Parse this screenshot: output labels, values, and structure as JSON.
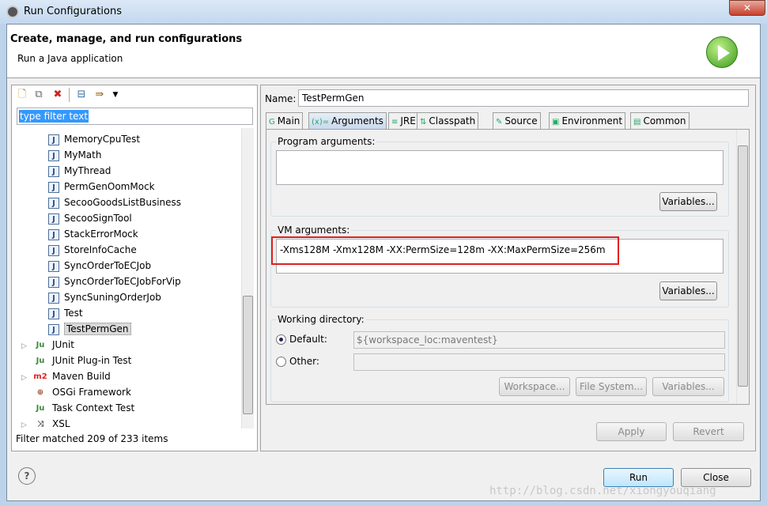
{
  "window": {
    "title": "Run Configurations",
    "close": "✕"
  },
  "header": {
    "title": "Create, manage, and run configurations",
    "subtitle": "Run a Java application"
  },
  "left": {
    "filter_value": "type filter text",
    "items": [
      {
        "label": "MemoryCpuTest",
        "icon": "java-class-icon"
      },
      {
        "label": "MyMath",
        "icon": "java-class-icon"
      },
      {
        "label": "MyThread",
        "icon": "java-class-icon"
      },
      {
        "label": "PermGenOomMock",
        "icon": "java-class-icon"
      },
      {
        "label": "SecooGoodsListBusiness",
        "icon": "java-class-icon"
      },
      {
        "label": "SecooSignTool",
        "icon": "java-class-icon"
      },
      {
        "label": "StackErrorMock",
        "icon": "java-class-icon"
      },
      {
        "label": "StoreInfoCache",
        "icon": "java-class-icon"
      },
      {
        "label": "SyncOrderToECJob",
        "icon": "java-class-icon"
      },
      {
        "label": "SyncOrderToECJobForVip",
        "icon": "java-class-icon"
      },
      {
        "label": "SyncSuningOrderJob",
        "icon": "java-class-icon"
      },
      {
        "label": "Test",
        "icon": "java-class-icon"
      },
      {
        "label": "TestPermGen",
        "icon": "java-class-icon",
        "selected": true
      }
    ],
    "categories": [
      {
        "label": "JUnit",
        "icon": "junit-icon",
        "glyph": "Ju",
        "expandable": true
      },
      {
        "label": "JUnit Plug-in Test",
        "icon": "junit-plugin-icon",
        "glyph": "Ju",
        "expandable": false
      },
      {
        "label": "Maven Build",
        "icon": "maven-icon",
        "glyph": "m2",
        "expandable": true
      },
      {
        "label": "OSGi Framework",
        "icon": "osgi-icon",
        "glyph": "⊕",
        "expandable": false
      },
      {
        "label": "Task Context Test",
        "icon": "task-context-icon",
        "glyph": "Ju",
        "expandable": false
      },
      {
        "label": "XSL",
        "icon": "xsl-icon",
        "glyph": "⤨",
        "expandable": true
      }
    ],
    "status": "Filter matched 209 of 233 items"
  },
  "right": {
    "name_label": "Name:",
    "name_value": "TestPermGen",
    "tabs": [
      {
        "label": "Main",
        "glyph": "G"
      },
      {
        "label": "Arguments",
        "glyph": "(x)=",
        "selected": true
      },
      {
        "label": "JRE",
        "glyph": "≡"
      },
      {
        "label": "Classpath",
        "glyph": "⇅"
      },
      {
        "label": "Source",
        "glyph": "✎"
      },
      {
        "label": "Environment",
        "glyph": "▣"
      },
      {
        "label": "Common",
        "glyph": "▤"
      }
    ],
    "program_args_label": "Program arguments:",
    "program_args_value": "",
    "vm_args_label": "VM arguments:",
    "vm_args_value": "-Xms128M -Xmx128M -XX:PermSize=128m -XX:MaxPermSize=256m",
    "variables": "Variables...",
    "workdir_label": "Working directory:",
    "default_label": "Default:",
    "default_value": "${workspace_loc:maventest}",
    "default_checked": true,
    "other_label": "Other:",
    "other_value": "",
    "workspace_btn": "Workspace...",
    "filesystem_btn": "File System...",
    "apply": "Apply",
    "revert": "Revert"
  },
  "footer": {
    "run": "Run",
    "close": "Close",
    "help": "?",
    "watermark": "http://blog.csdn.net/xiongyouqiang"
  },
  "colors": {
    "highlight": "#3399ff",
    "red_box": "#e02020"
  }
}
